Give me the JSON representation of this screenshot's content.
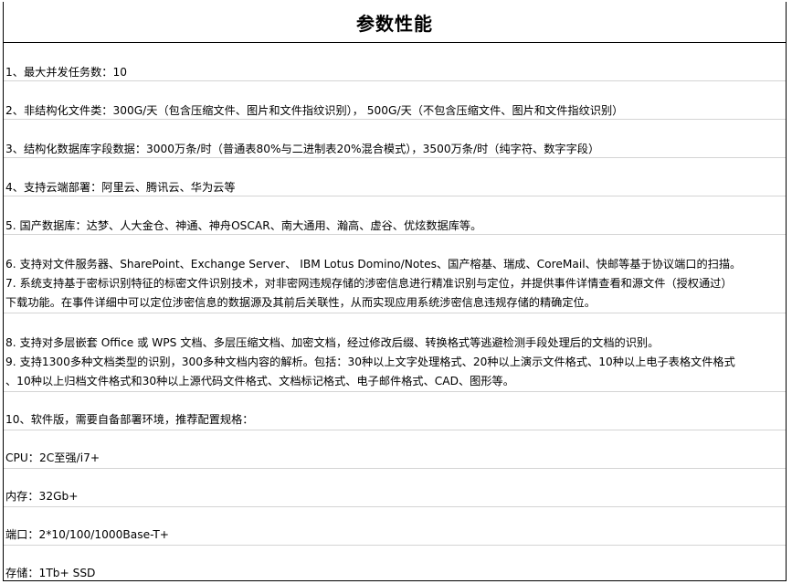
{
  "title": "参数性能",
  "items": [
    "1、最大并发任务数：10",
    "2、非结构化文件类：300G/天（包含压缩文件、图片和文件指纹识别），  500G/天（不包含压缩文件、图片和文件指纹识别）",
    "3、结构化数据库字段数据：3000万条/时（普通表80%与二进制表20%混合模式），3500万条/时（纯字符、数字字段）",
    "4、支持云端部署：阿里云、腾讯云、华为云等",
    "5. 国产数据库：达梦、人大金仓、神通、神舟OSCAR、南大通用、瀚高、虚谷、优炫数据库等。",
    "6. 支持对文件服务器、SharePoint、Exchange Server、 IBM Lotus Domino/Notes、国产榕基、瑞成、CoreMail、快邮等基于协议端口的扫描。",
    "7. 系统支持基于密标识别特征的标密文件识别技术，对非密网违规存储的涉密信息进行精准识别与定位，并提供事件详情查看和源文件（授权通过）",
    "下载功能。在事件详细中可以定位涉密信息的数据源及其前后关联性，从而实现应用系统涉密信息违规存储的精确定位。",
    "8. 支持对多层嵌套 Office 或 WPS 文档、多层压缩文档、加密文档，经过修改后缀、转换格式等逃避检测手段处理后的文档的识别。",
    "9. 支持1300多种文档类型的识别，300多种文档内容的解析。包括：30种以上文字处理格式、20种以上演示文件格式、10种以上电子表格文件格式",
    "、10种以上归档文件格式和30种以上源代码文件格式、文档标记格式、电子邮件格式、CAD、图形等。",
    "10、软件版，需要自备部署环境，推荐配置规格：",
    "CPU：2C至强/i7+",
    "内存：32Gb+",
    "端口：2*10/100/1000Base-T+",
    "存储：1Tb+ SSD"
  ]
}
